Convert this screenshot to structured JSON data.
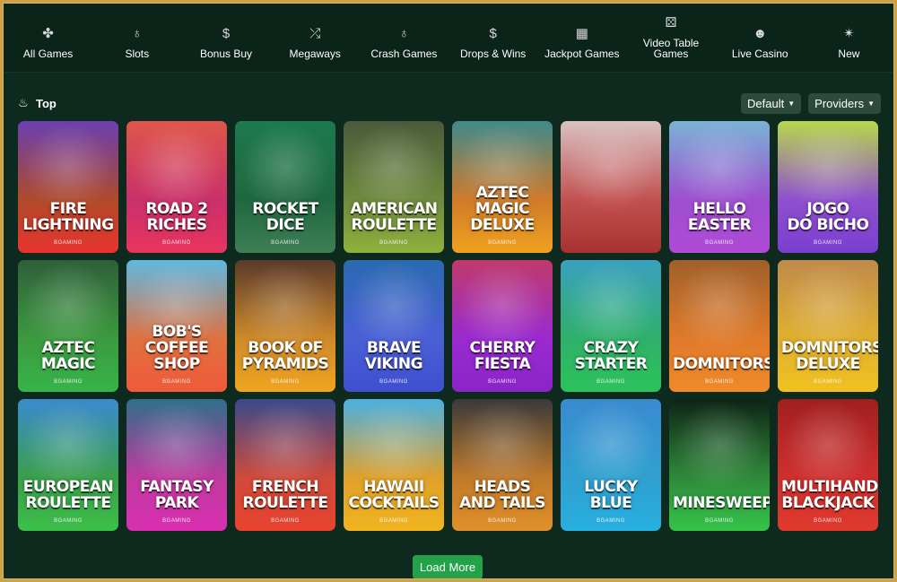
{
  "nav": [
    {
      "label": "All Games",
      "icon": "clover-icon",
      "glyph": "✤"
    },
    {
      "label": "Slots",
      "icon": "cherries-icon",
      "glyph": "♁"
    },
    {
      "label": "Bonus Buy",
      "icon": "money-bag-icon",
      "glyph": "$"
    },
    {
      "label": "Megaways",
      "icon": "shuffle-icon",
      "glyph": "⤮"
    },
    {
      "label": "Crash Games",
      "icon": "cherries-icon",
      "glyph": "♁"
    },
    {
      "label": "Drops & Wins",
      "icon": "money-bag-icon",
      "glyph": "$"
    },
    {
      "label": "Jackpot Games",
      "icon": "slot-reels-icon",
      "glyph": "▦"
    },
    {
      "label": "Video Table\nGames",
      "icon": "dice-icon",
      "glyph": "⚄"
    },
    {
      "label": "Live Casino",
      "icon": "dealer-icon",
      "glyph": "☻"
    },
    {
      "label": "New",
      "icon": "sparkle-icon",
      "glyph": "✴"
    }
  ],
  "section": {
    "title": "Top",
    "icon": "flame-icon"
  },
  "filters": {
    "sort_label": "Default",
    "providers_label": "Providers"
  },
  "games": [
    {
      "title": "Fire\nLightning",
      "provider": "BGAMING",
      "top": "#6a3fb0",
      "mid": "#b04a2a",
      "bottom": "#e8332f"
    },
    {
      "title": "Road 2\nRiches",
      "provider": "BGAMING",
      "top": "#e0564a",
      "mid": "#c9306a",
      "bottom": "#e8345f"
    },
    {
      "title": "Rocket\nDice",
      "provider": "BGAMING",
      "top": "#1c7a4e",
      "mid": "#20683f",
      "bottom": "#3f7f55"
    },
    {
      "title": "American\nRoulette",
      "provider": "BGAMING",
      "top": "#4a5a3a",
      "mid": "#6f8a3f",
      "bottom": "#8fb13c"
    },
    {
      "title": "Aztec Magic\nDeluxe",
      "provider": "BGAMING",
      "top": "#3f8a8a",
      "mid": "#d07a2a",
      "bottom": "#f0a21f"
    },
    {
      "title": "",
      "provider": "",
      "top": "#d9c2c2",
      "mid": "#c25050",
      "bottom": "#a83232"
    },
    {
      "title": "Hello\nEaster",
      "provider": "BGAMING",
      "top": "#7ab3d6",
      "mid": "#9d4fcf",
      "bottom": "#b04ad6"
    },
    {
      "title": "Jogo\ndo Bicho",
      "provider": "BGAMING",
      "top": "#b7d84a",
      "mid": "#8f4fd0",
      "bottom": "#7a3fd0"
    },
    {
      "title": "Aztec\nMagic",
      "provider": "BGAMING",
      "top": "#2f5f3a",
      "mid": "#3c9a3f",
      "bottom": "#36b44a"
    },
    {
      "title": "Bob's Coffee\nShop",
      "provider": "BGAMING",
      "top": "#5fb8e0",
      "mid": "#e0703f",
      "bottom": "#f05a3a"
    },
    {
      "title": "Book of\nPyramids",
      "provider": "BGAMING",
      "top": "#5a3a2a",
      "mid": "#d08a2a",
      "bottom": "#f0a51f"
    },
    {
      "title": "Brave\nViking",
      "provider": "BGAMING",
      "top": "#2a6ab0",
      "mid": "#4a5fd6",
      "bottom": "#3f4fd0"
    },
    {
      "title": "Cherry\nFiesta",
      "provider": "BGAMING",
      "top": "#c03a6a",
      "mid": "#9a2ad0",
      "bottom": "#8a25c8"
    },
    {
      "title": "Crazy\nStarter",
      "provider": "BGAMING",
      "top": "#3aa0c0",
      "mid": "#2fb06a",
      "bottom": "#2cc35a"
    },
    {
      "title": "Domnitors",
      "provider": "BGAMING",
      "top": "#a0602a",
      "mid": "#e07a2a",
      "bottom": "#f08a2a"
    },
    {
      "title": "Domnitors\nDeluxe",
      "provider": "BGAMING",
      "top": "#c08a4a",
      "mid": "#e0b030",
      "bottom": "#f0c11f"
    },
    {
      "title": "European\nRoulette",
      "provider": "BGAMING",
      "top": "#3a8ad0",
      "mid": "#3aa04a",
      "bottom": "#3cbf4a"
    },
    {
      "title": "Fantasy\nPark",
      "provider": "BGAMING",
      "top": "#2f6f8a",
      "mid": "#c03aa0",
      "bottom": "#d92fb0"
    },
    {
      "title": "French\nRoulette",
      "provider": "BGAMING",
      "top": "#3a4a8a",
      "mid": "#d04a3a",
      "bottom": "#e8432f"
    },
    {
      "title": "Hawaii\nCocktails",
      "provider": "BGAMING",
      "top": "#4ab0e0",
      "mid": "#e0a02a",
      "bottom": "#f0b51f"
    },
    {
      "title": "Heads\nand Tails",
      "provider": "BGAMING",
      "top": "#3a3a3a",
      "mid": "#c07a2a",
      "bottom": "#e0902a"
    },
    {
      "title": "Lucky\nBlue",
      "provider": "BGAMING",
      "top": "#3a8ad0",
      "mid": "#2fa0d0",
      "bottom": "#27b0e0"
    },
    {
      "title": "Minesweeper",
      "provider": "BGAMING",
      "top": "#0e2416",
      "mid": "#2f8a3a",
      "bottom": "#35c44a"
    },
    {
      "title": "Multihand\nBlackjack",
      "provider": "BGAMING",
      "top": "#a01f1f",
      "mid": "#d0302f",
      "bottom": "#e03a2f"
    }
  ],
  "load_more_label": "Load More"
}
